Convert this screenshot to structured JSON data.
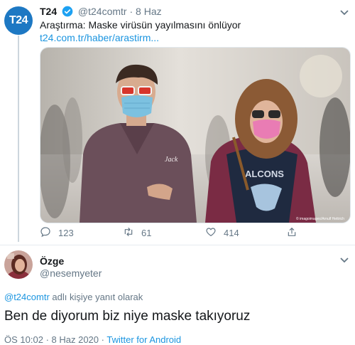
{
  "tweet1": {
    "avatar_text": "T24",
    "display_name": "T24",
    "handle": "@t24comtr",
    "separator": "·",
    "date": "8 Haz",
    "text": "Araştırma: Maske virüsün yayılmasını önlüyor",
    "link": "t24.com.tr/haber/arastirm...",
    "photo_credit": "© imagoimages/Arnulf Hettrich",
    "counts": {
      "replies": "123",
      "retweets": "61",
      "likes": "414"
    }
  },
  "tweet2": {
    "display_name": "Özge",
    "handle": "@nesemyeter",
    "reply_handle": "@t24comtr",
    "reply_suffix": " adlı kişiye yanıt olarak",
    "text": "Ben de diyorum biz niye maske takıyoruz",
    "time": "ÖS 10:02",
    "date": "8 Haz 2020",
    "source": "Twitter for Android"
  },
  "colors": {
    "accent": "#1b95e0",
    "muted": "#657786",
    "t24_blue": "#1d78c3"
  },
  "icons": [
    "verified-badge-icon",
    "chevron-down-icon",
    "reply-icon",
    "retweet-icon",
    "like-icon",
    "share-icon"
  ]
}
